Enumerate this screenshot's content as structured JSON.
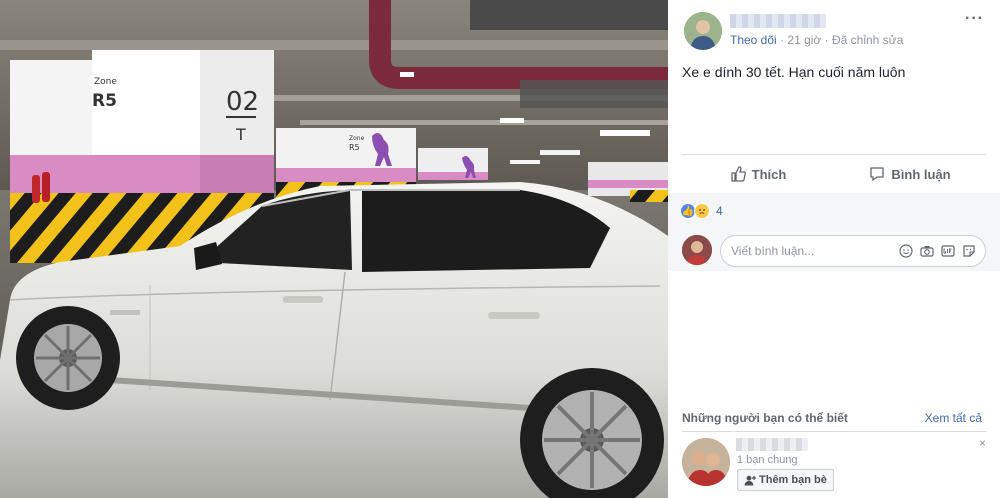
{
  "post": {
    "author_name": "",
    "follow_label": "Theo dõi",
    "separator": "·",
    "time": "21 giờ",
    "edited": "Đã chỉnh sửa",
    "text": "Xe e dính 30 tết. Hạn cuối năm luôn"
  },
  "photo": {
    "zone_word": "Zone",
    "zone_code": "R5",
    "pillar_number": "02",
    "pillar_letter": "T"
  },
  "actions": {
    "like_label": "Thích",
    "comment_label": "Bình luận"
  },
  "reactions": {
    "count": "4"
  },
  "comment": {
    "placeholder": "Viết bình luận..."
  },
  "pymk": {
    "title": "Những người bạn có thể biết",
    "see_all": "Xem tất cả",
    "mutual": "1 bạn chung",
    "add_friend_label": "Thêm bạn bè",
    "close": "×"
  },
  "colors": {
    "link": "#4267b2",
    "muted": "#90949c",
    "pillar_pink": "#d98bc4",
    "hazard_yellow": "#f2c21b",
    "bear_purple": "#8a4fb0"
  }
}
